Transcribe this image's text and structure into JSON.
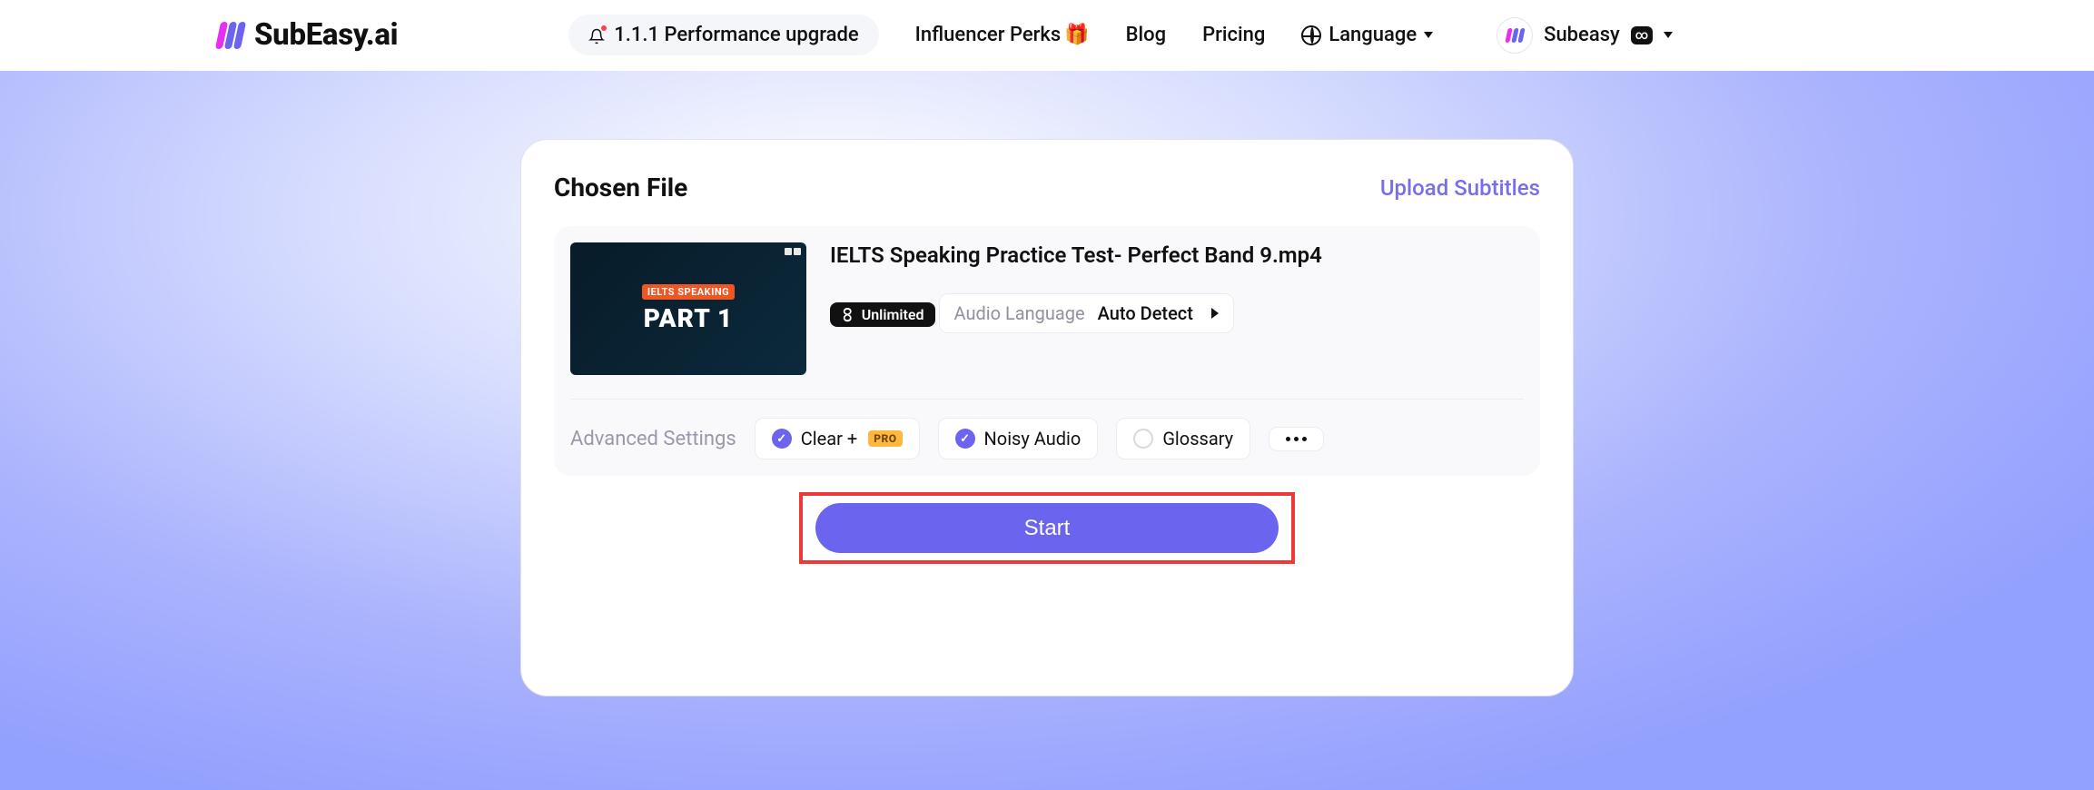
{
  "brand": "SubEasy.ai",
  "nav": {
    "announce": "1.1.1 Performance upgrade",
    "perks": "Influencer Perks",
    "blog": "Blog",
    "pricing": "Pricing",
    "language": "Language"
  },
  "profile": {
    "name": "Subeasy",
    "badge": "∞"
  },
  "card": {
    "title": "Chosen File",
    "upload": "Upload Subtitles",
    "file": {
      "name": "IELTS Speaking Practice Test- Perfect Band 9.mp4",
      "unlimited": "Unlimited",
      "thumb_tag": "IELTS SPEAKING",
      "thumb_big": "PART 1",
      "audio_label": "Audio Language",
      "audio_value": "Auto Detect"
    },
    "adv": {
      "title": "Advanced Settings",
      "clear": "Clear +",
      "pro": "PRO",
      "noisy": "Noisy Audio",
      "glossary": "Glossary"
    },
    "start": "Start"
  }
}
